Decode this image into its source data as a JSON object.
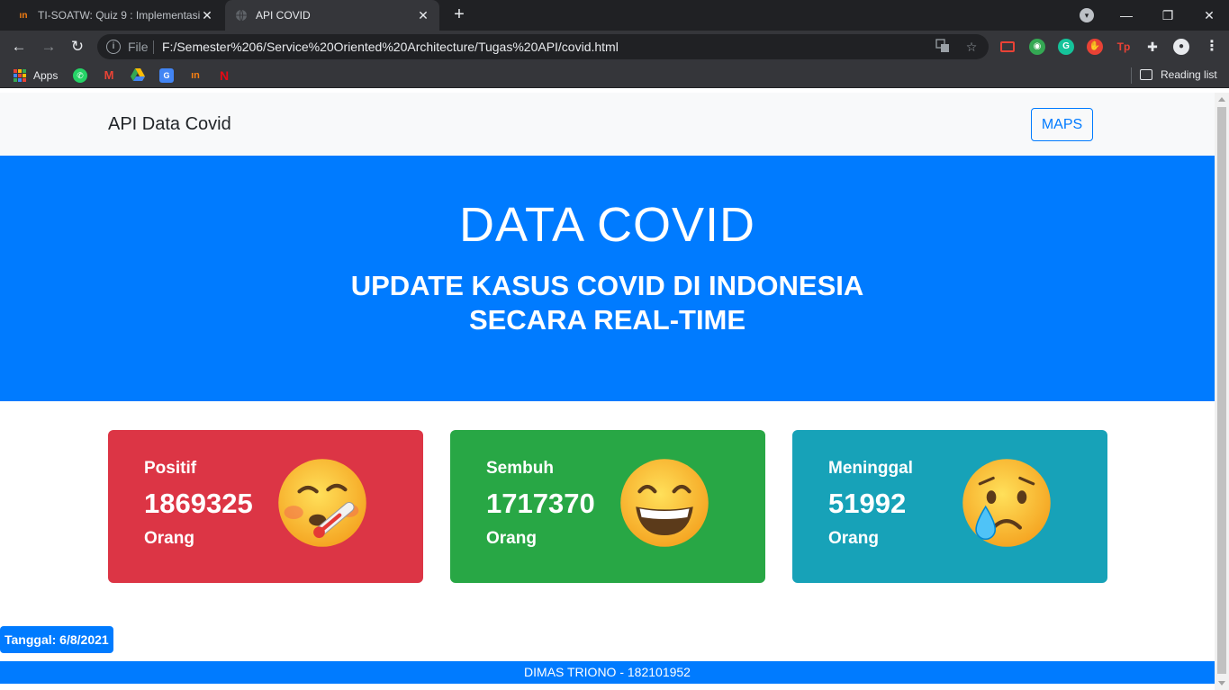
{
  "browser": {
    "tabs": [
      {
        "title": "TI-SOATW: Quiz 9 : Implementasi",
        "favicon": "moodle-icon",
        "active": false
      },
      {
        "title": "API COVID",
        "favicon": "globe-icon",
        "active": true
      }
    ],
    "new_tab": "+",
    "omnibox": {
      "scheme_label": "File",
      "url": "F:/Semester%206/Service%20Oriented%20Architecture/Tugas%20API/covid.html"
    },
    "bookmarks": {
      "apps_label": "Apps",
      "reading_list_label": "Reading list"
    }
  },
  "navbar": {
    "brand": "API Data Covid",
    "maps_button": "MAPS"
  },
  "hero": {
    "title": "DATA COVID",
    "subtitle_line1": "UPDATE KASUS COVID DI INDONESIA",
    "subtitle_line2": "SECARA REAL-TIME"
  },
  "cards": [
    {
      "label": "Positif",
      "value": "1869325",
      "unit": "Orang",
      "color": "#dc3545",
      "emoji": "face-with-thermometer-icon"
    },
    {
      "label": "Sembuh",
      "value": "1717370",
      "unit": "Orang",
      "color": "#28a745",
      "emoji": "grinning-face-icon"
    },
    {
      "label": "Meninggal",
      "value": "51992",
      "unit": "Orang",
      "color": "#17a2b8",
      "emoji": "crying-face-icon"
    }
  ],
  "date_badge": "Tanggal: 6/8/2021",
  "footer": "DIMAS TRIONO - 182101952",
  "colors": {
    "primary": "#007bff",
    "navbar_bg": "#f8f9fa",
    "chrome_dark": "#202124",
    "chrome_toolbar": "#35363a"
  }
}
